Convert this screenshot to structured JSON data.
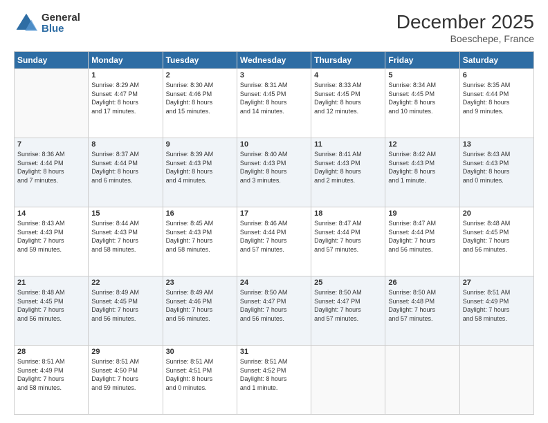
{
  "logo": {
    "line1": "General",
    "line2": "Blue"
  },
  "title": "December 2025",
  "location": "Boeschepe, France",
  "days_header": [
    "Sunday",
    "Monday",
    "Tuesday",
    "Wednesday",
    "Thursday",
    "Friday",
    "Saturday"
  ],
  "weeks": [
    [
      {
        "day": "",
        "info": ""
      },
      {
        "day": "1",
        "info": "Sunrise: 8:29 AM\nSunset: 4:47 PM\nDaylight: 8 hours\nand 17 minutes."
      },
      {
        "day": "2",
        "info": "Sunrise: 8:30 AM\nSunset: 4:46 PM\nDaylight: 8 hours\nand 15 minutes."
      },
      {
        "day": "3",
        "info": "Sunrise: 8:31 AM\nSunset: 4:45 PM\nDaylight: 8 hours\nand 14 minutes."
      },
      {
        "day": "4",
        "info": "Sunrise: 8:33 AM\nSunset: 4:45 PM\nDaylight: 8 hours\nand 12 minutes."
      },
      {
        "day": "5",
        "info": "Sunrise: 8:34 AM\nSunset: 4:45 PM\nDaylight: 8 hours\nand 10 minutes."
      },
      {
        "day": "6",
        "info": "Sunrise: 8:35 AM\nSunset: 4:44 PM\nDaylight: 8 hours\nand 9 minutes."
      }
    ],
    [
      {
        "day": "7",
        "info": "Sunrise: 8:36 AM\nSunset: 4:44 PM\nDaylight: 8 hours\nand 7 minutes."
      },
      {
        "day": "8",
        "info": "Sunrise: 8:37 AM\nSunset: 4:44 PM\nDaylight: 8 hours\nand 6 minutes."
      },
      {
        "day": "9",
        "info": "Sunrise: 8:39 AM\nSunset: 4:43 PM\nDaylight: 8 hours\nand 4 minutes."
      },
      {
        "day": "10",
        "info": "Sunrise: 8:40 AM\nSunset: 4:43 PM\nDaylight: 8 hours\nand 3 minutes."
      },
      {
        "day": "11",
        "info": "Sunrise: 8:41 AM\nSunset: 4:43 PM\nDaylight: 8 hours\nand 2 minutes."
      },
      {
        "day": "12",
        "info": "Sunrise: 8:42 AM\nSunset: 4:43 PM\nDaylight: 8 hours\nand 1 minute."
      },
      {
        "day": "13",
        "info": "Sunrise: 8:43 AM\nSunset: 4:43 PM\nDaylight: 8 hours\nand 0 minutes."
      }
    ],
    [
      {
        "day": "14",
        "info": "Sunrise: 8:43 AM\nSunset: 4:43 PM\nDaylight: 7 hours\nand 59 minutes."
      },
      {
        "day": "15",
        "info": "Sunrise: 8:44 AM\nSunset: 4:43 PM\nDaylight: 7 hours\nand 58 minutes."
      },
      {
        "day": "16",
        "info": "Sunrise: 8:45 AM\nSunset: 4:43 PM\nDaylight: 7 hours\nand 58 minutes."
      },
      {
        "day": "17",
        "info": "Sunrise: 8:46 AM\nSunset: 4:44 PM\nDaylight: 7 hours\nand 57 minutes."
      },
      {
        "day": "18",
        "info": "Sunrise: 8:47 AM\nSunset: 4:44 PM\nDaylight: 7 hours\nand 57 minutes."
      },
      {
        "day": "19",
        "info": "Sunrise: 8:47 AM\nSunset: 4:44 PM\nDaylight: 7 hours\nand 56 minutes."
      },
      {
        "day": "20",
        "info": "Sunrise: 8:48 AM\nSunset: 4:45 PM\nDaylight: 7 hours\nand 56 minutes."
      }
    ],
    [
      {
        "day": "21",
        "info": "Sunrise: 8:48 AM\nSunset: 4:45 PM\nDaylight: 7 hours\nand 56 minutes."
      },
      {
        "day": "22",
        "info": "Sunrise: 8:49 AM\nSunset: 4:45 PM\nDaylight: 7 hours\nand 56 minutes."
      },
      {
        "day": "23",
        "info": "Sunrise: 8:49 AM\nSunset: 4:46 PM\nDaylight: 7 hours\nand 56 minutes."
      },
      {
        "day": "24",
        "info": "Sunrise: 8:50 AM\nSunset: 4:47 PM\nDaylight: 7 hours\nand 56 minutes."
      },
      {
        "day": "25",
        "info": "Sunrise: 8:50 AM\nSunset: 4:47 PM\nDaylight: 7 hours\nand 57 minutes."
      },
      {
        "day": "26",
        "info": "Sunrise: 8:50 AM\nSunset: 4:48 PM\nDaylight: 7 hours\nand 57 minutes."
      },
      {
        "day": "27",
        "info": "Sunrise: 8:51 AM\nSunset: 4:49 PM\nDaylight: 7 hours\nand 58 minutes."
      }
    ],
    [
      {
        "day": "28",
        "info": "Sunrise: 8:51 AM\nSunset: 4:49 PM\nDaylight: 7 hours\nand 58 minutes."
      },
      {
        "day": "29",
        "info": "Sunrise: 8:51 AM\nSunset: 4:50 PM\nDaylight: 7 hours\nand 59 minutes."
      },
      {
        "day": "30",
        "info": "Sunrise: 8:51 AM\nSunset: 4:51 PM\nDaylight: 8 hours\nand 0 minutes."
      },
      {
        "day": "31",
        "info": "Sunrise: 8:51 AM\nSunset: 4:52 PM\nDaylight: 8 hours\nand 1 minute."
      },
      {
        "day": "",
        "info": ""
      },
      {
        "day": "",
        "info": ""
      },
      {
        "day": "",
        "info": ""
      }
    ]
  ]
}
